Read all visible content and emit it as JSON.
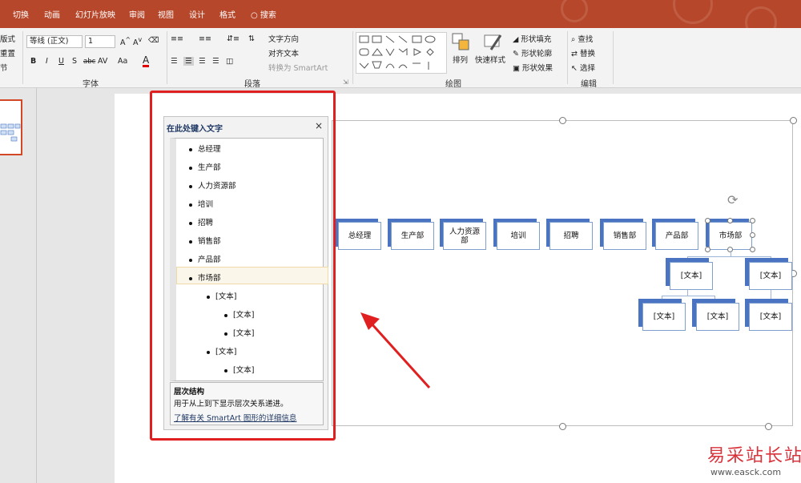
{
  "tabs": [
    "切换",
    "动画",
    "幻灯片放映",
    "审阅",
    "视图",
    "设计",
    "格式"
  ],
  "search_label": "搜索",
  "ribbon": {
    "left_cut": {
      "layout": "版式",
      "reset": "重置",
      "section": "节"
    },
    "font": {
      "name": "等线 (正文)",
      "size": "1",
      "group_label": "字体",
      "bold": "B",
      "italic": "I",
      "underline": "U",
      "shadow": "S",
      "strike": "abc",
      "spacing": "AV",
      "case": "Aa",
      "color": "A"
    },
    "paragraph": {
      "text_direction": "文字方向",
      "align_text": "对齐文本",
      "convert_smartart": "转换为 SmartArt",
      "group_label": "段落"
    },
    "drawing": {
      "arrange": "排列",
      "quick_styles": "快速样式",
      "shape_fill": "形状填充",
      "shape_outline": "形状轮廓",
      "shape_effects": "形状效果",
      "group_label": "绘图"
    },
    "editing": {
      "find": "查找",
      "replace": "替换",
      "select": "选择",
      "group_label": "编辑"
    }
  },
  "text_pane": {
    "title": "在此处键入文字",
    "close": "×",
    "items": [
      {
        "text": "总经理",
        "level": 1
      },
      {
        "text": "生产部",
        "level": 1
      },
      {
        "text": "人力资源部",
        "level": 1
      },
      {
        "text": "培训",
        "level": 1
      },
      {
        "text": "招聘",
        "level": 1
      },
      {
        "text": "销售部",
        "level": 1
      },
      {
        "text": "产品部",
        "level": 1
      },
      {
        "text": "市场部",
        "level": 1
      },
      {
        "text": "[文本]",
        "level": 2
      },
      {
        "text": "[文本]",
        "level": 3
      },
      {
        "text": "[文本]",
        "level": 3
      },
      {
        "text": "[文本]",
        "level": 2
      },
      {
        "text": "[文本]",
        "level": 3
      }
    ],
    "desc_title": "层次结构",
    "desc_text": "用于从上到下显示层次关系递进。",
    "desc_link": "了解有关 SmartArt 图形的详细信息"
  },
  "smartart": {
    "top_row": [
      "总经理",
      "生产部",
      "人力资源部",
      "培训",
      "招聘",
      "销售部",
      "产品部",
      "市场部"
    ],
    "level2": [
      "[文本]",
      "[文本]"
    ],
    "level3": [
      "[文本]",
      "[文本]",
      "[文本]"
    ]
  },
  "colors": {
    "accent": "#b7472a",
    "node_blue": "#4a73c1",
    "annotation_red": "#e02020"
  },
  "watermark": {
    "title": "易采站长站",
    "url": "www.easck.com"
  }
}
